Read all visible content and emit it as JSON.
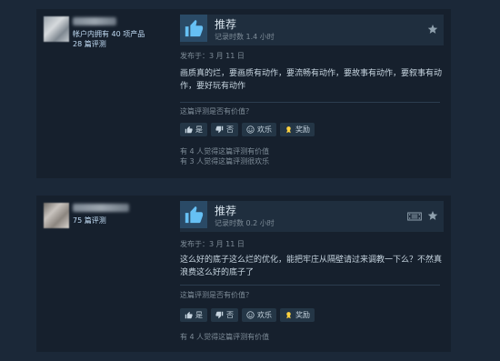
{
  "reviews": [
    {
      "author": {
        "products_owned": "帐户内拥有 40 项产品",
        "review_count": "28 篇评测"
      },
      "recommendation": "推荐",
      "hours": "记录时数 1.4 小时",
      "posted": "发布于：3 月 11 日",
      "content": "画质真的烂，要画质有动作，要流畅有动作，要故事有动作，要叙事有动作，要好玩有动作",
      "helpful_question": "这篇评测是否有价值？",
      "buttons": {
        "yes": "是",
        "no": "否",
        "funny": "欢乐",
        "award": "奖励"
      },
      "stats": [
        "有 4 人觉得这篇评测有价值",
        "有 3 人觉得这篇评测很欢乐"
      ]
    },
    {
      "author": {
        "review_count": "75 篇评测"
      },
      "recommendation": "推荐",
      "hours": "记录时数 0.2 小时",
      "posted": "发布于：3 月 11 日",
      "content": "这么好的底子这么烂的优化，能把牢庄从隔壁请过来调教一下么？不然真浪费这么好的底子了",
      "helpful_question": "这篇评测是否有价值？",
      "buttons": {
        "yes": "是",
        "no": "否",
        "funny": "欢乐",
        "award": "奖励"
      },
      "stats": [
        "有 4 人觉得这篇评测有价值"
      ]
    }
  ],
  "colors": {
    "background": "#1b2838",
    "panel": "#16202d",
    "thumb_box": "#2a4a66",
    "thumb": "#66c0f4",
    "award": "#ffd23f"
  }
}
